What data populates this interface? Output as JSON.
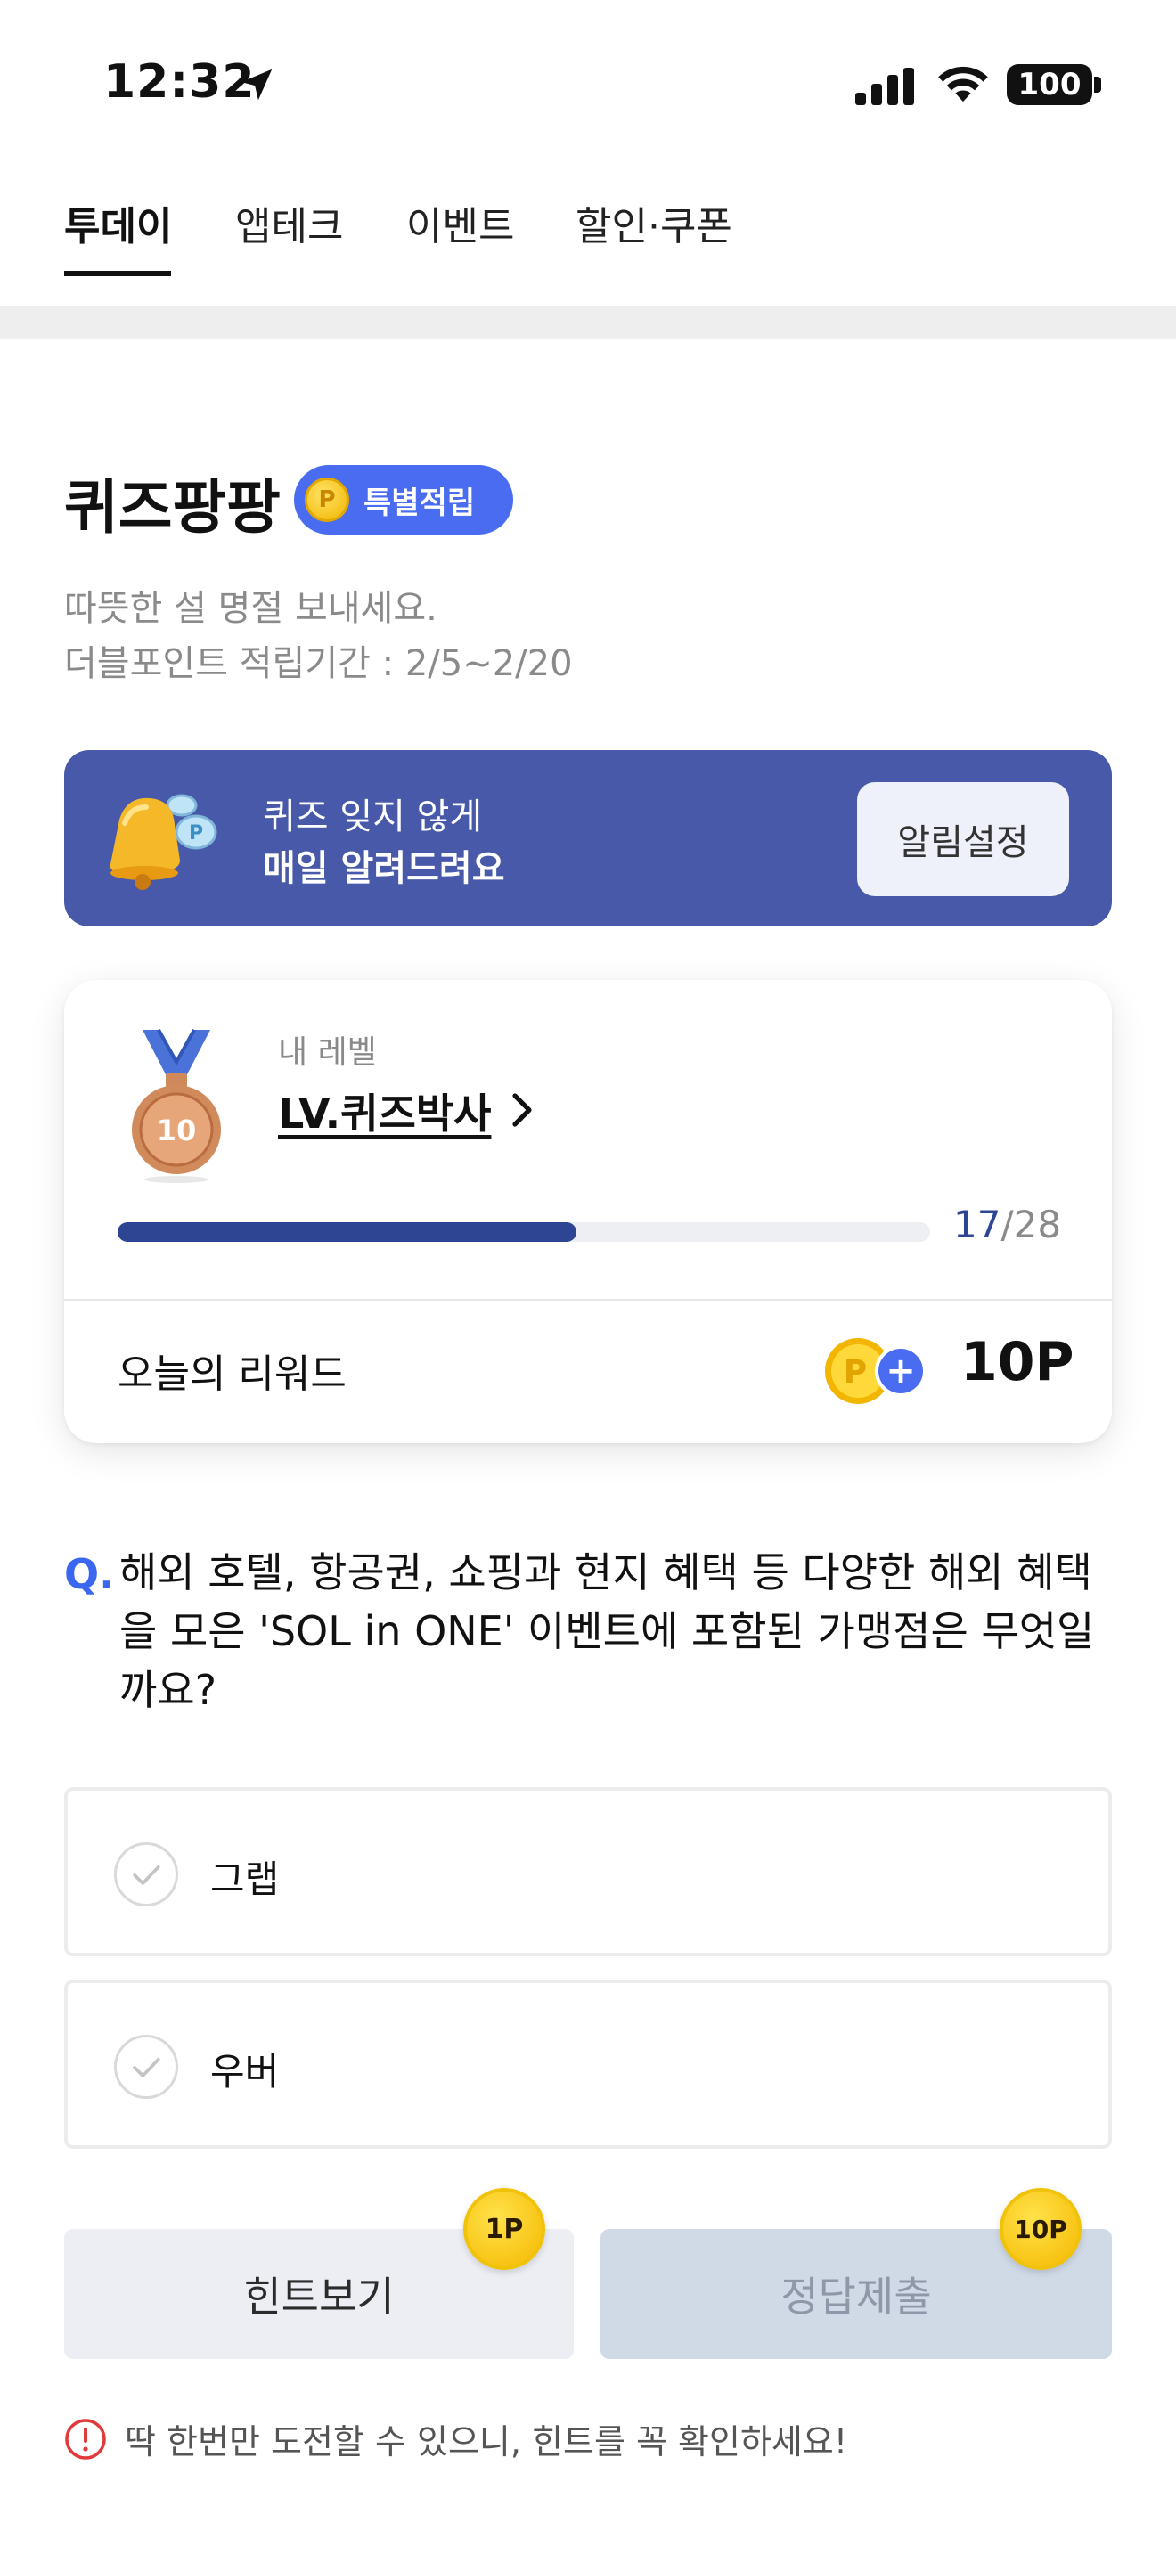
{
  "status_bar": {
    "time": "12:32",
    "battery": "100",
    "icons": [
      "location-arrow-icon",
      "cellular-signal-icon",
      "wifi-icon",
      "battery-icon"
    ]
  },
  "tabs": [
    {
      "label": "투데이",
      "active": true
    },
    {
      "label": "앱테크",
      "active": false
    },
    {
      "label": "이벤트",
      "active": false
    },
    {
      "label": "할인·쿠폰",
      "active": false
    }
  ],
  "quiz": {
    "title": "퀴즈팡팡",
    "badge_label": "특별적립",
    "badge_coin": "P",
    "subtitle_line1": "따뜻한 설 명절 보내세요.",
    "subtitle_line2": "더블포인트 적립기간 : 2/5~2/20"
  },
  "notify_banner": {
    "line1": "퀴즈 잊지 않게",
    "line2": "매일 알려드려요",
    "button_label": "알림설정",
    "background_color": "#4759a8"
  },
  "level_card": {
    "medal_number": "10",
    "my_level_label": "내 레벨",
    "level_name": "LV.퀴즈박사",
    "progress_current": "17",
    "progress_separator": "/",
    "progress_total": "28",
    "progress_fraction": 0.565,
    "reward_label": "오늘의 리워드",
    "reward_coin": "P",
    "reward_plus": "+",
    "reward_amount": "10P"
  },
  "question": {
    "marker": "Q.",
    "text": "해외 호텔, 항공권, 쇼핑과 현지 혜택 등 다양한 해외 혜택을 모은 'SOL in ONE' 이벤트에 포함된 가맹점은 무엇일까요?"
  },
  "options": [
    {
      "label": "그랩"
    },
    {
      "label": "우버"
    }
  ],
  "buttons": {
    "hint_label": "힌트보기",
    "hint_cost": "1P",
    "submit_label": "정답제출",
    "submit_cost": "10P"
  },
  "warning": {
    "text": "딱 한번만 도전할 수 있으니, 힌트를 꼭 확인하세요!"
  },
  "colors": {
    "accent_blue": "#4a6cf0",
    "progress_fill": "#2e4594",
    "question_marker": "#3a66f0",
    "warning_red": "#e03b3b"
  }
}
